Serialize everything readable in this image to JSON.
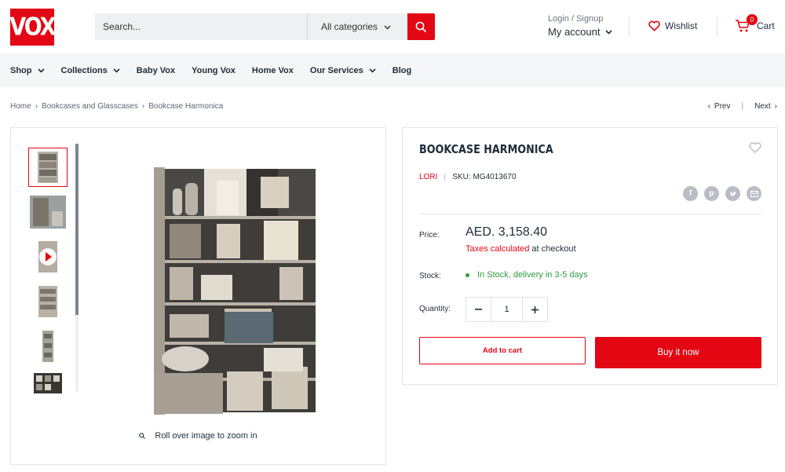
{
  "brand": {
    "logo_text": "VOX",
    "accent": "#e30613"
  },
  "search": {
    "placeholder": "Search...",
    "category": "All categories"
  },
  "account": {
    "login_label": "Login / Signup",
    "account_label": "My account"
  },
  "wishlist": {
    "label": "Wishlist"
  },
  "cart": {
    "label": "Cart",
    "count": "0"
  },
  "nav": {
    "items": [
      {
        "label": "Shop",
        "dropdown": true
      },
      {
        "label": "Collections",
        "dropdown": true
      },
      {
        "label": "Baby Vox",
        "dropdown": false
      },
      {
        "label": "Young Vox",
        "dropdown": false
      },
      {
        "label": "Home Vox",
        "dropdown": false
      },
      {
        "label": "Our Services",
        "dropdown": true
      },
      {
        "label": "Blog",
        "dropdown": false
      }
    ]
  },
  "breadcrumb": [
    "Home",
    "Bookcases and Glasscases",
    "Bookcase Harmonica"
  ],
  "pager": {
    "prev": "Prev",
    "next": "Next"
  },
  "gallery": {
    "zoom_hint": "Roll over image to zoom in",
    "thumbnail_count": 6,
    "active_thumbnail": 1
  },
  "product": {
    "title": "BOOKCASE HARMONICA",
    "vendor": "LORI",
    "sku": "SKU: MG4013670",
    "price_label": "Price:",
    "price": "AED. 3,158.40",
    "tax_link": "Taxes calculated",
    "tax_rest": " at checkout",
    "stock_label": "Stock:",
    "stock_value": "In Stock, delivery in 3-5 days",
    "quantity_label": "Quantity:",
    "quantity": "1",
    "add_to_cart": "Add to cart",
    "buy_now": "Buy it now",
    "share_icons": [
      "facebook-icon",
      "pinterest-icon",
      "twitter-icon",
      "email-icon"
    ]
  }
}
